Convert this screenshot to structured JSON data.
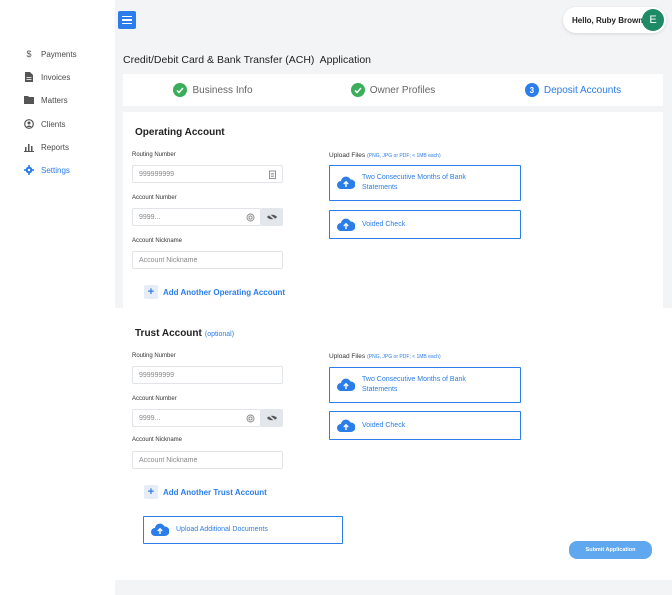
{
  "sidebar": {
    "items": [
      {
        "label": "Payments",
        "icon": "dollar-icon"
      },
      {
        "label": "Invoices",
        "icon": "document-icon"
      },
      {
        "label": "Matters",
        "icon": "folder-icon"
      },
      {
        "label": "Clients",
        "icon": "user-circle-icon"
      },
      {
        "label": "Reports",
        "icon": "bar-chart-icon"
      },
      {
        "label": "Settings",
        "icon": "gear-icon"
      }
    ]
  },
  "header": {
    "greeting": "Hello, Ruby Brown",
    "avatar_initial": "E"
  },
  "page": {
    "title": "Credit/Debit Card & Bank Transfer (ACH)  Application"
  },
  "steps": [
    {
      "label": "Business Info",
      "state": "complete"
    },
    {
      "label": "Owner Profiles",
      "state": "complete"
    },
    {
      "label": "Deposit Accounts",
      "state": "current",
      "number": "3"
    }
  ],
  "operating": {
    "title": "Operating Account",
    "routing_label": "Routing Number",
    "routing_placeholder": "999999999",
    "account_label": "Account Number",
    "account_placeholder": "9999...",
    "nickname_label": "Account Nickname",
    "nickname_placeholder": "Account Nickname",
    "upload_label": "Upload Files",
    "upload_hint": "(PNG, JPG or PDF; < 1MB each)",
    "upload_statements": "Two Consecutive Months of Bank Statements",
    "upload_check": "Voided Check",
    "add_link": "Add Another Operating Account"
  },
  "trust": {
    "title": "Trust Account",
    "optional": "(optional)",
    "routing_label": "Routing Number",
    "routing_placeholder": "999999999",
    "account_label": "Account Number",
    "account_placeholder": "9999...",
    "nickname_label": "Account Nickname",
    "nickname_placeholder": "Account Nickname",
    "upload_label": "Upload Files",
    "upload_hint": "(PNG, JPG or PDF; < 1MB each)",
    "upload_statements": "Two Consecutive Months of Bank Statements",
    "upload_check": "Voided Check",
    "add_link": "Add Another Trust Account"
  },
  "additional": {
    "label": "Upload Additional Documents"
  },
  "submit": {
    "label": "Submit Application"
  },
  "colors": {
    "accent": "#2b7de9",
    "success": "#3aae5a",
    "avatar": "#1e8a66"
  }
}
